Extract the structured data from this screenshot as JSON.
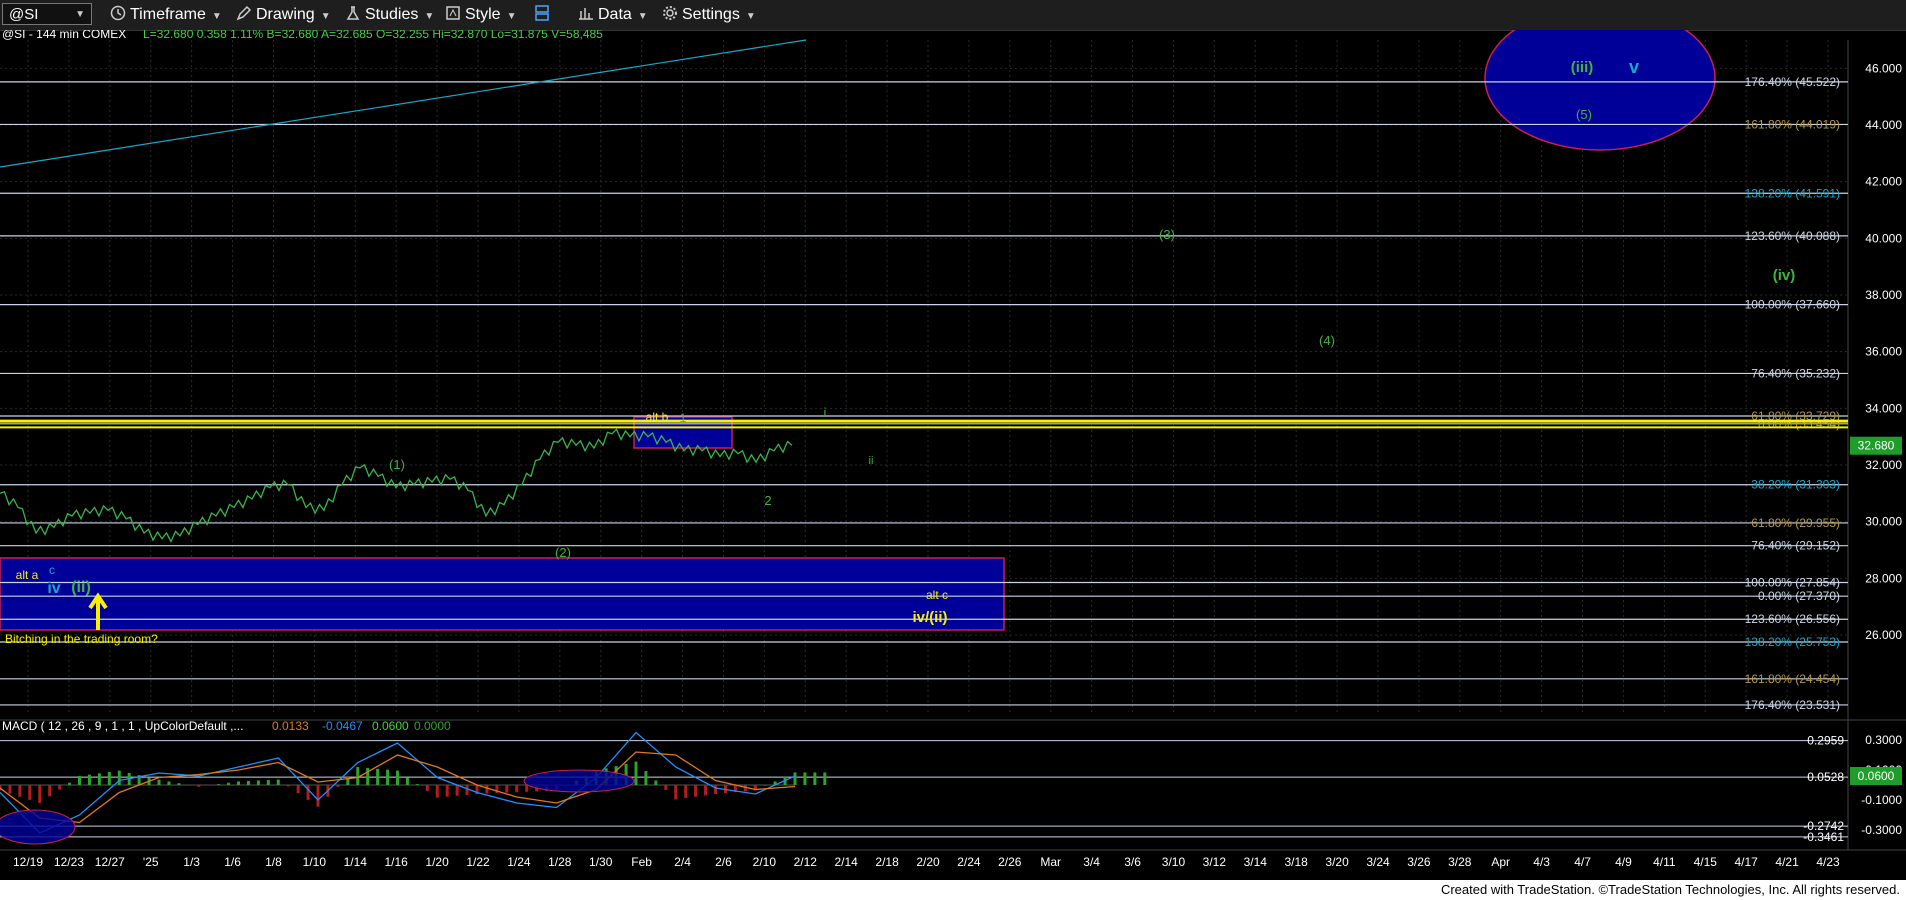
{
  "toolbar": {
    "symbol": "@SI",
    "timeframe": "Timeframe",
    "drawing": "Drawing",
    "studies": "Studies",
    "style": "Style",
    "data": "Data",
    "settings": "Settings"
  },
  "header_info": "@SI - 144 min  COMEX",
  "header_values": "L=32.680  0.358  1.11%  B=32.680  A=32.685  O=32.255  Hi=32.870  Lo=31.875  V=58,485",
  "footer": "Created with TradeStation. ©TradeStation Technologies, Inc. All rights reserved.",
  "colors": {
    "price": "#39b54a",
    "fib_line": "#c9d3e6",
    "yellow": "#f7f000",
    "box_fill": "#000099",
    "box_border": "#cc1f4a",
    "cyan": "#1ba7c9",
    "green_label": "#3fb43f",
    "last_price_bg": "#1f9d2a"
  },
  "chart_data": [
    {
      "type": "line",
      "title": "@SI - 144 min COMEX",
      "ylim": [
        23.0,
        47.0
      ],
      "y_ticks": [
        "46.000",
        "44.000",
        "42.000",
        "40.000",
        "38.000",
        "36.000",
        "34.000",
        "32.000",
        "30.000",
        "28.000",
        "26.000"
      ],
      "x_tick_labels": [
        "12/19",
        "12/23",
        "12/27",
        "'25",
        "1/3",
        "1/6",
        "1/8",
        "1/10",
        "1/14",
        "1/16",
        "1/20",
        "1/22",
        "1/24",
        "1/28",
        "1/30",
        "Feb",
        "2/4",
        "2/6",
        "2/10",
        "2/12",
        "2/14",
        "2/18",
        "2/20",
        "2/24",
        "2/26",
        "Mar",
        "3/4",
        "3/6",
        "3/10",
        "3/12",
        "3/14",
        "3/18",
        "3/20",
        "3/24",
        "3/26",
        "3/28",
        "Apr",
        "4/3",
        "4/7",
        "4/9",
        "4/11",
        "4/15",
        "4/17",
        "4/21",
        "4/23"
      ],
      "last_price": "32.680",
      "series": [
        {
          "values": [
            31.0,
            30.5,
            29.6,
            29.8,
            30.2,
            30.3,
            30.4,
            30.1,
            29.6,
            29.4,
            29.5,
            29.9,
            30.2,
            30.5,
            30.8,
            31.2,
            31.3,
            30.5,
            30.4,
            31.3,
            31.9,
            31.6,
            31.2,
            31.3,
            31.4,
            31.5,
            31.1,
            30.2,
            30.6,
            31.3,
            32.2,
            32.8,
            32.7,
            32.6,
            33.1,
            33.0,
            33.0,
            32.8,
            32.5,
            32.5,
            32.3,
            32.4,
            32.1,
            32.5,
            32.7
          ]
        }
      ],
      "fib_levels": [
        {
          "label": "176.40% (45.522)",
          "value": 45.522,
          "color": "#ccd6e6"
        },
        {
          "label": "161.80% (44.019)",
          "value": 44.019,
          "color": "#b59a4a"
        },
        {
          "label": "138.20% (41.591)",
          "value": 41.591,
          "color": "#1ba7c9"
        },
        {
          "label": "123.60% (40.088)",
          "value": 40.088,
          "color": "#ccd6e6"
        },
        {
          "label": "100.00% (37.660)",
          "value": 37.66,
          "color": "#ccd6e6"
        },
        {
          "label": "76.40% (35.232)",
          "value": 35.232,
          "color": "#ccd6e6"
        },
        {
          "label": "61.80% (33.729)",
          "value": 33.729,
          "color": "#b59a4a"
        },
        {
          "label": "0.00% (33.454)",
          "value": 33.454,
          "color": "#b59a4a"
        },
        {
          "label": "38.20% (31.303)",
          "value": 31.303,
          "color": "#1ba7c9"
        },
        {
          "label": "61.80% (29.955)",
          "value": 29.955,
          "color": "#b59a4a"
        },
        {
          "label": "76.40% (29.152)",
          "value": 29.152,
          "color": "#ccd6e6"
        },
        {
          "label": "100.00% (27.854)",
          "value": 27.854,
          "color": "#ccd6e6"
        },
        {
          "label": "0.00% (27.370)",
          "value": 27.37,
          "color": "#ccd6e6"
        },
        {
          "label": "123.60% (26.556)",
          "value": 26.556,
          "color": "#ccd6e6"
        },
        {
          "label": "138.20% (25.753)",
          "value": 25.753,
          "color": "#1ba7c9"
        },
        {
          "label": "161.80% (24.454)",
          "value": 24.454,
          "color": "#b59a4a"
        },
        {
          "label": "176.40% (23.531)",
          "value": 23.531,
          "color": "#ccd6e6"
        }
      ],
      "wave_labels": [
        "(iii)",
        "v",
        "(5)",
        "(3)",
        "(iv)",
        "(4)",
        "i",
        "ii",
        "alt b",
        "1",
        "2",
        "(1)",
        "(2)",
        "alt a",
        "c",
        "iv",
        "(ii)",
        "alt c",
        "iv/(ii)",
        "Bitching in the trading room?"
      ]
    },
    {
      "type": "line",
      "title": "MACD ( 12 , 26 , 9 , 1 , 1 , UpColorDefault ,...",
      "legend_values": [
        "0.0133",
        "-0.0467",
        "0.0600",
        "0.0000"
      ],
      "y_ticks": [
        "0.3000",
        "0.1000",
        "-0.1000",
        "-0.3000"
      ],
      "level_labels": [
        "0.2959",
        "0.0528",
        "-0.2742",
        "-0.3461"
      ],
      "last_value": "0.0600",
      "series": [
        {
          "name": "MACD",
          "values": [
            -0.05,
            -0.32,
            -0.2,
            0.03,
            0.08,
            0.06,
            0.12,
            0.18,
            -0.1,
            0.15,
            0.28,
            0.05,
            -0.05,
            -0.12,
            -0.15,
            0.05,
            0.35,
            0.12,
            -0.02,
            -0.06,
            0.06
          ]
        },
        {
          "name": "Signal",
          "values": [
            -0.02,
            -0.22,
            -0.25,
            -0.05,
            0.05,
            0.07,
            0.1,
            0.15,
            0.02,
            0.05,
            0.2,
            0.12,
            0.0,
            -0.08,
            -0.12,
            -0.03,
            0.22,
            0.2,
            0.03,
            -0.03,
            -0.01
          ]
        }
      ]
    }
  ]
}
